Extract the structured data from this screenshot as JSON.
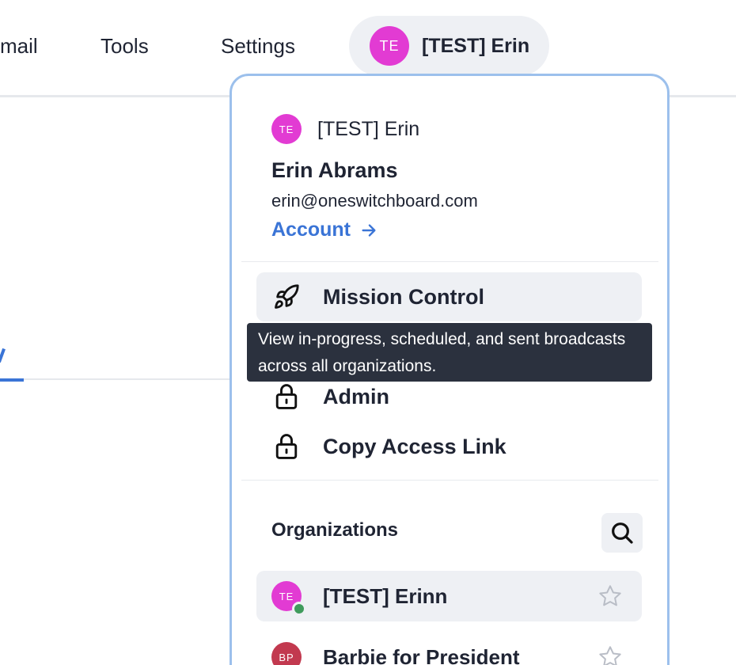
{
  "nav": {
    "items": [
      "mail",
      "Tools",
      "Settings"
    ],
    "user": {
      "initials": "TE",
      "name": "[TEST] Erin",
      "avatar_color": "#e23bd3"
    }
  },
  "dropdown": {
    "org": {
      "initials": "TE",
      "name": "[TEST] Erin",
      "avatar_color": "#e23bd3"
    },
    "user_name": "Erin Abrams",
    "email": "erin@oneswitchboard.com",
    "account_label": "Account",
    "menu": [
      {
        "label": "Mission Control",
        "icon": "rocket-icon"
      },
      {
        "label": "Admin",
        "icon": "lock-icon"
      },
      {
        "label": "Copy Access Link",
        "icon": "lock-icon"
      }
    ],
    "tooltip": "View in-progress, scheduled, and sent broadcasts across all organizations.",
    "organizations_title": "Organizations",
    "organizations": [
      {
        "initials": "TE",
        "name": "[TEST] Erinn",
        "avatar_color": "#e23bd3",
        "active": true,
        "online": true
      },
      {
        "initials": "BP",
        "name": "Barbie for President",
        "avatar_color": "#c2394f",
        "active": false,
        "online": false
      }
    ]
  },
  "colors": {
    "accent": "#3a74d6",
    "dropdown_border": "#9cc0ec",
    "tooltip_bg": "#2b313e"
  }
}
